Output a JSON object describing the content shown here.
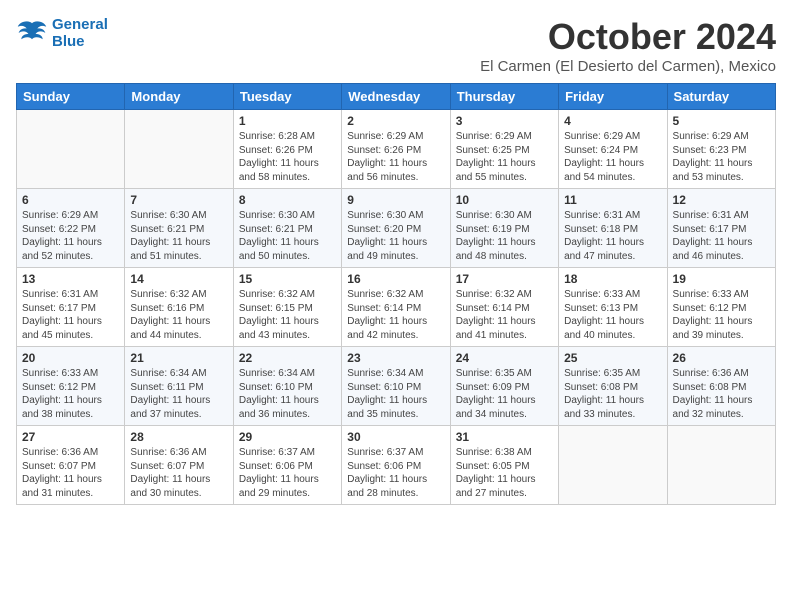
{
  "header": {
    "logo_line1": "General",
    "logo_line2": "Blue",
    "month": "October 2024",
    "location": "El Carmen (El Desierto del Carmen), Mexico"
  },
  "weekdays": [
    "Sunday",
    "Monday",
    "Tuesday",
    "Wednesday",
    "Thursday",
    "Friday",
    "Saturday"
  ],
  "weeks": [
    [
      {
        "day": "",
        "info": ""
      },
      {
        "day": "",
        "info": ""
      },
      {
        "day": "1",
        "info": "Sunrise: 6:28 AM\nSunset: 6:26 PM\nDaylight: 11 hours and 58 minutes."
      },
      {
        "day": "2",
        "info": "Sunrise: 6:29 AM\nSunset: 6:26 PM\nDaylight: 11 hours and 56 minutes."
      },
      {
        "day": "3",
        "info": "Sunrise: 6:29 AM\nSunset: 6:25 PM\nDaylight: 11 hours and 55 minutes."
      },
      {
        "day": "4",
        "info": "Sunrise: 6:29 AM\nSunset: 6:24 PM\nDaylight: 11 hours and 54 minutes."
      },
      {
        "day": "5",
        "info": "Sunrise: 6:29 AM\nSunset: 6:23 PM\nDaylight: 11 hours and 53 minutes."
      }
    ],
    [
      {
        "day": "6",
        "info": "Sunrise: 6:29 AM\nSunset: 6:22 PM\nDaylight: 11 hours and 52 minutes."
      },
      {
        "day": "7",
        "info": "Sunrise: 6:30 AM\nSunset: 6:21 PM\nDaylight: 11 hours and 51 minutes."
      },
      {
        "day": "8",
        "info": "Sunrise: 6:30 AM\nSunset: 6:21 PM\nDaylight: 11 hours and 50 minutes."
      },
      {
        "day": "9",
        "info": "Sunrise: 6:30 AM\nSunset: 6:20 PM\nDaylight: 11 hours and 49 minutes."
      },
      {
        "day": "10",
        "info": "Sunrise: 6:30 AM\nSunset: 6:19 PM\nDaylight: 11 hours and 48 minutes."
      },
      {
        "day": "11",
        "info": "Sunrise: 6:31 AM\nSunset: 6:18 PM\nDaylight: 11 hours and 47 minutes."
      },
      {
        "day": "12",
        "info": "Sunrise: 6:31 AM\nSunset: 6:17 PM\nDaylight: 11 hours and 46 minutes."
      }
    ],
    [
      {
        "day": "13",
        "info": "Sunrise: 6:31 AM\nSunset: 6:17 PM\nDaylight: 11 hours and 45 minutes."
      },
      {
        "day": "14",
        "info": "Sunrise: 6:32 AM\nSunset: 6:16 PM\nDaylight: 11 hours and 44 minutes."
      },
      {
        "day": "15",
        "info": "Sunrise: 6:32 AM\nSunset: 6:15 PM\nDaylight: 11 hours and 43 minutes."
      },
      {
        "day": "16",
        "info": "Sunrise: 6:32 AM\nSunset: 6:14 PM\nDaylight: 11 hours and 42 minutes."
      },
      {
        "day": "17",
        "info": "Sunrise: 6:32 AM\nSunset: 6:14 PM\nDaylight: 11 hours and 41 minutes."
      },
      {
        "day": "18",
        "info": "Sunrise: 6:33 AM\nSunset: 6:13 PM\nDaylight: 11 hours and 40 minutes."
      },
      {
        "day": "19",
        "info": "Sunrise: 6:33 AM\nSunset: 6:12 PM\nDaylight: 11 hours and 39 minutes."
      }
    ],
    [
      {
        "day": "20",
        "info": "Sunrise: 6:33 AM\nSunset: 6:12 PM\nDaylight: 11 hours and 38 minutes."
      },
      {
        "day": "21",
        "info": "Sunrise: 6:34 AM\nSunset: 6:11 PM\nDaylight: 11 hours and 37 minutes."
      },
      {
        "day": "22",
        "info": "Sunrise: 6:34 AM\nSunset: 6:10 PM\nDaylight: 11 hours and 36 minutes."
      },
      {
        "day": "23",
        "info": "Sunrise: 6:34 AM\nSunset: 6:10 PM\nDaylight: 11 hours and 35 minutes."
      },
      {
        "day": "24",
        "info": "Sunrise: 6:35 AM\nSunset: 6:09 PM\nDaylight: 11 hours and 34 minutes."
      },
      {
        "day": "25",
        "info": "Sunrise: 6:35 AM\nSunset: 6:08 PM\nDaylight: 11 hours and 33 minutes."
      },
      {
        "day": "26",
        "info": "Sunrise: 6:36 AM\nSunset: 6:08 PM\nDaylight: 11 hours and 32 minutes."
      }
    ],
    [
      {
        "day": "27",
        "info": "Sunrise: 6:36 AM\nSunset: 6:07 PM\nDaylight: 11 hours and 31 minutes."
      },
      {
        "day": "28",
        "info": "Sunrise: 6:36 AM\nSunset: 6:07 PM\nDaylight: 11 hours and 30 minutes."
      },
      {
        "day": "29",
        "info": "Sunrise: 6:37 AM\nSunset: 6:06 PM\nDaylight: 11 hours and 29 minutes."
      },
      {
        "day": "30",
        "info": "Sunrise: 6:37 AM\nSunset: 6:06 PM\nDaylight: 11 hours and 28 minutes."
      },
      {
        "day": "31",
        "info": "Sunrise: 6:38 AM\nSunset: 6:05 PM\nDaylight: 11 hours and 27 minutes."
      },
      {
        "day": "",
        "info": ""
      },
      {
        "day": "",
        "info": ""
      }
    ]
  ]
}
